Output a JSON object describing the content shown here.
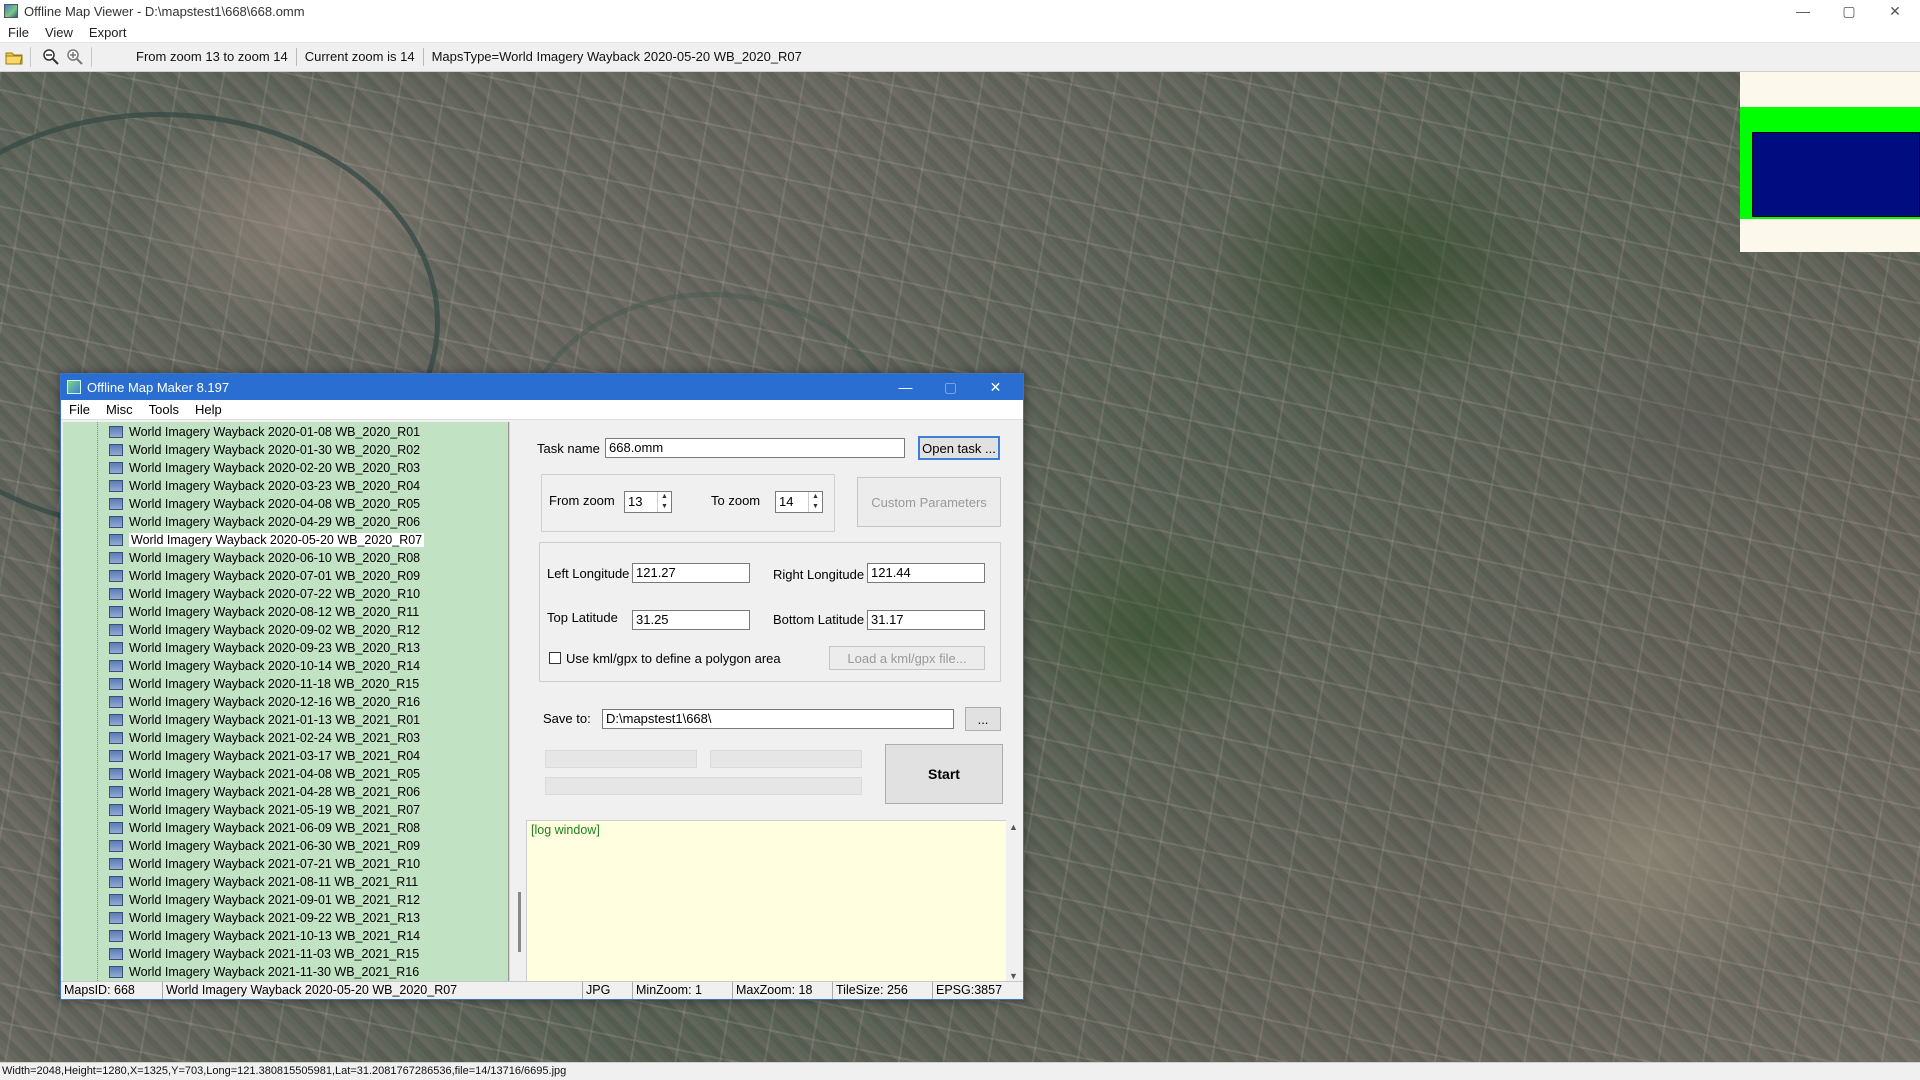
{
  "window": {
    "title": "Offline Map Viewer - D:\\mapstest1\\668\\668.omm",
    "controls": {
      "minimize": "—",
      "maximize": "▢",
      "close": "✕"
    }
  },
  "menu": [
    "File",
    "View",
    "Export"
  ],
  "toolbar": {
    "zoom_range": "From zoom 13 to zoom 14",
    "current_zoom": "Current zoom is 14",
    "maps_type": "MapsType=World Imagery Wayback 2020-05-20 WB_2020_R07"
  },
  "statusbar": {
    "text": "Width=2048,Height=1280,X=1325,Y=703,Long=121.380815505981,Lat=31.2081767286536,file=14/13716/6695.jpg"
  },
  "overview_colors": {
    "background": "#fdf8ec",
    "band": "#00ff00",
    "viewport": "#000c80"
  },
  "dialog": {
    "title": "Offline Map Maker 8.197",
    "menu": [
      "File",
      "Misc",
      "Tools",
      "Help"
    ],
    "tree": {
      "items": [
        "World Imagery Wayback 2020-01-08 WB_2020_R01",
        "World Imagery Wayback 2020-01-30 WB_2020_R02",
        "World Imagery Wayback 2020-02-20 WB_2020_R03",
        "World Imagery Wayback 2020-03-23 WB_2020_R04",
        "World Imagery Wayback 2020-04-08 WB_2020_R05",
        "World Imagery Wayback 2020-04-29 WB_2020_R06",
        "World Imagery Wayback 2020-05-20 WB_2020_R07",
        "World Imagery Wayback 2020-06-10 WB_2020_R08",
        "World Imagery Wayback 2020-07-01 WB_2020_R09",
        "World Imagery Wayback 2020-07-22 WB_2020_R10",
        "World Imagery Wayback 2020-08-12 WB_2020_R11",
        "World Imagery Wayback 2020-09-02 WB_2020_R12",
        "World Imagery Wayback 2020-09-23 WB_2020_R13",
        "World Imagery Wayback 2020-10-14 WB_2020_R14",
        "World Imagery Wayback 2020-11-18 WB_2020_R15",
        "World Imagery Wayback 2020-12-16 WB_2020_R16",
        "World Imagery Wayback 2021-01-13 WB_2021_R01",
        "World Imagery Wayback 2021-02-24 WB_2021_R03",
        "World Imagery Wayback 2021-03-17 WB_2021_R04",
        "World Imagery Wayback 2021-04-08 WB_2021_R05",
        "World Imagery Wayback 2021-04-28 WB_2021_R06",
        "World Imagery Wayback 2021-05-19 WB_2021_R07",
        "World Imagery Wayback 2021-06-09 WB_2021_R08",
        "World Imagery Wayback 2021-06-30 WB_2021_R09",
        "World Imagery Wayback 2021-07-21 WB_2021_R10",
        "World Imagery Wayback 2021-08-11 WB_2021_R11",
        "World Imagery Wayback 2021-09-01 WB_2021_R12",
        "World Imagery Wayback 2021-09-22 WB_2021_R13",
        "World Imagery Wayback 2021-10-13 WB_2021_R14",
        "World Imagery Wayback 2021-11-03 WB_2021_R15",
        "World Imagery Wayback 2021-11-30 WB_2021_R16"
      ],
      "selected_index": 6
    },
    "task": {
      "label": "Task name",
      "value": "668.omm",
      "open_button": "Open task ..."
    },
    "zoom": {
      "from_label": "From zoom",
      "from_value": "13",
      "to_label": "To zoom",
      "to_value": "14",
      "custom_button": "Custom Parameters"
    },
    "coords": {
      "left_label": "Left Longitude",
      "left_value": "121.27",
      "right_label": "Right Longitude",
      "right_value": "121.44",
      "top_label": "Top Latitude",
      "top_value": "31.25",
      "bottom_label": "Bottom Latitude",
      "bottom_value": "31.17",
      "kml_label": "Use kml/gpx to define a polygon area",
      "kml_button": "Load a kml/gpx file..."
    },
    "save": {
      "label": "Save to:",
      "value": "D:\\mapstest1\\668\\",
      "browse_button": "..."
    },
    "start_button": "Start",
    "log": {
      "text": "[log window]"
    },
    "status": {
      "maps_id": "MapsID: 668",
      "maps_name": "World Imagery Wayback 2020-05-20 WB_2020_R07",
      "format": "JPG",
      "min_zoom": "MinZoom: 1",
      "max_zoom": "MaxZoom: 18",
      "tile_size": "TileSize: 256",
      "epsg": "EPSG:3857"
    }
  }
}
